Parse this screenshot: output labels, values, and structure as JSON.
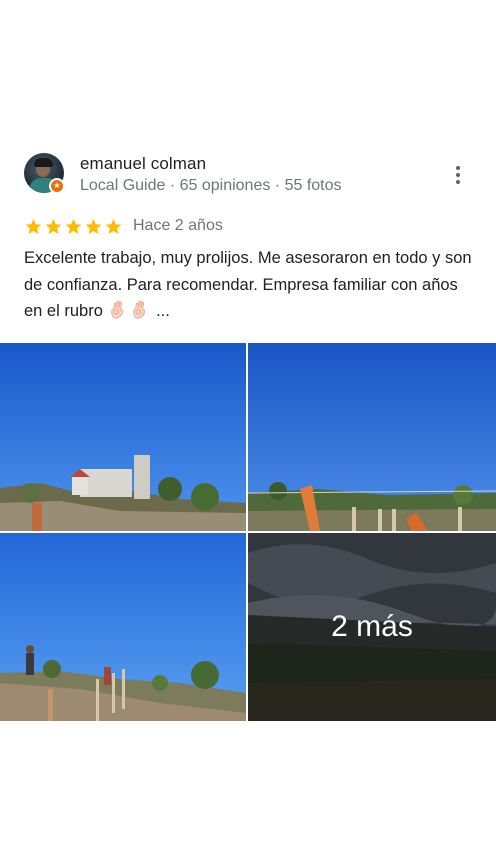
{
  "reviewer": {
    "name": "emanuel colman",
    "meta": "Local Guide · 65 opiniones · 55 fotos",
    "avatar_icon": "user-avatar",
    "badge_icon": "local-guide-star-icon",
    "badge_color": "#e8710a"
  },
  "rating": {
    "stars": 5,
    "star_color": "#fbbc04",
    "time": "Hace 2 años"
  },
  "review": {
    "text": "Excelente trabajo, muy prolijos. Me asesoraron en todo y son de confianza. Para recomendar. Empresa familiar con años en el rubro",
    "ellipsis": "...",
    "emoji_icons": [
      "ok-hand-emoji",
      "ok-hand-emoji"
    ]
  },
  "photos": {
    "more_label": "2 más"
  }
}
